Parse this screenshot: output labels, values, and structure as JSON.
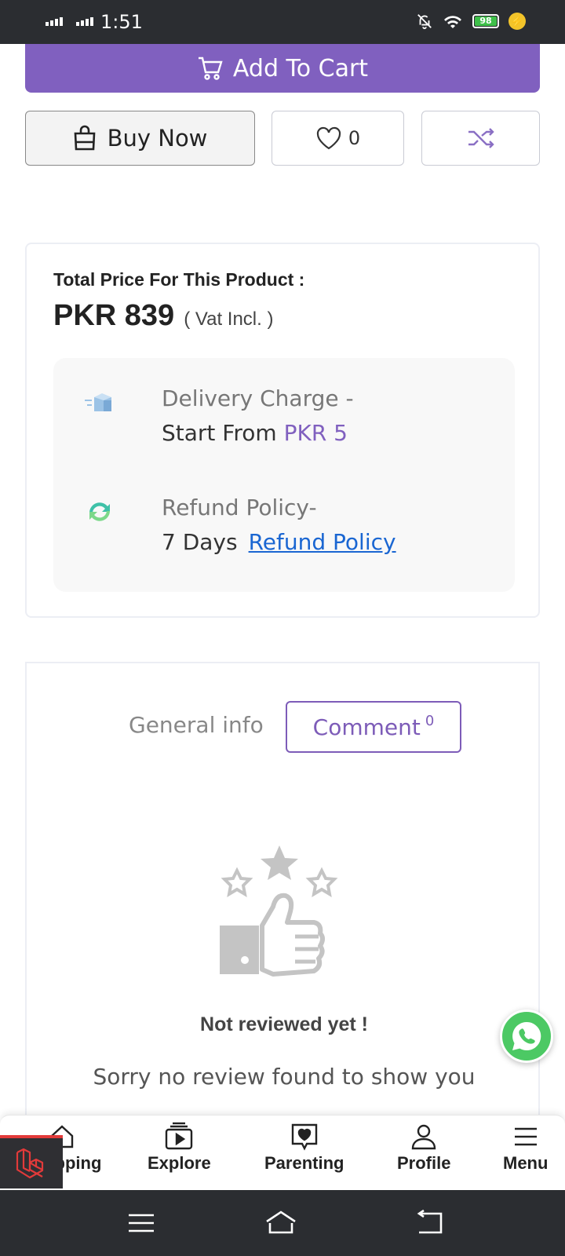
{
  "status_bar": {
    "time": "1:51",
    "battery_level": "98",
    "icons": [
      "signal-icon",
      "signal-icon",
      "bell-off-icon",
      "wifi-icon",
      "battery-icon",
      "charging-icon"
    ]
  },
  "actions": {
    "add_to_cart_label": "Add To Cart",
    "buy_now_label": "Buy Now",
    "wishlist_count": "0"
  },
  "price": {
    "label": "Total Price For This Product :",
    "value": "PKR 839",
    "vat_note": "( Vat Incl. )"
  },
  "delivery": {
    "title": "Delivery Charge -",
    "prefix": "Start From ",
    "amount": "PKR 5"
  },
  "refund": {
    "title": "Refund Policy-",
    "days": "7 Days",
    "link": "Refund Policy"
  },
  "tabs": {
    "general": "General info",
    "comment": "Comment",
    "comment_count": "0"
  },
  "reviews": {
    "empty_title": "Not reviewed yet !",
    "empty_text": "Sorry no review found to show you"
  },
  "bottom_nav": [
    {
      "label": "Shopping",
      "icon": "home-icon"
    },
    {
      "label": "Explore",
      "icon": "play-icon"
    },
    {
      "label": "Parenting",
      "icon": "heart-chat-icon"
    },
    {
      "label": "Profile",
      "icon": "user-icon"
    },
    {
      "label": "Menu",
      "icon": "menu-icon"
    }
  ],
  "colors": {
    "primary": "#8060bf",
    "link": "#1a66d2",
    "whatsapp": "#4cc964",
    "status_bar": "#2b2d31"
  }
}
